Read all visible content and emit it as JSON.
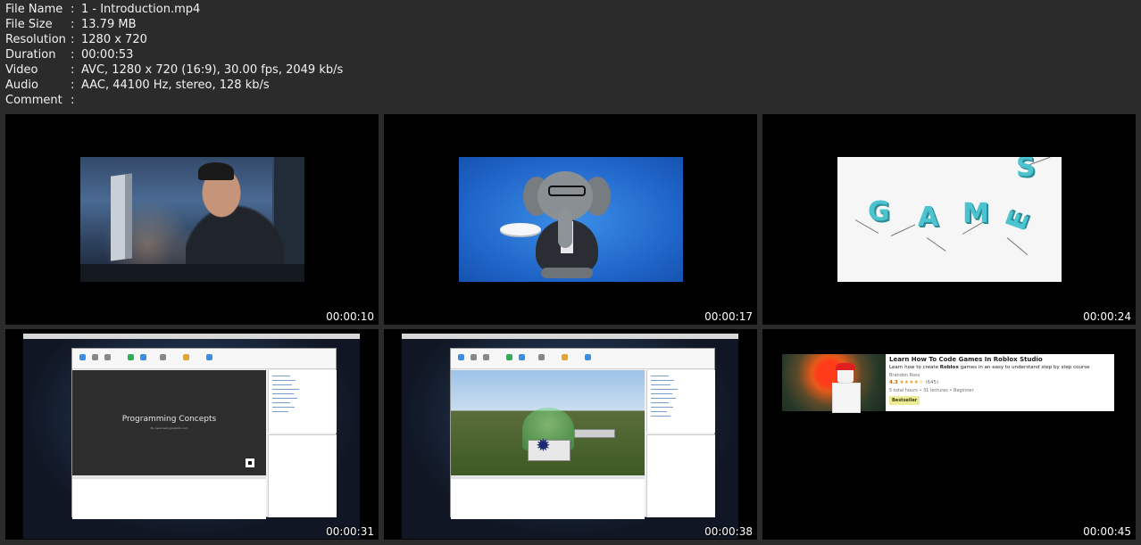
{
  "info": [
    {
      "key": "File Name",
      "value": "1 - Introduction.mp4"
    },
    {
      "key": "File Size",
      "value": "13.79 MB"
    },
    {
      "key": "Resolution",
      "value": "1280 x 720"
    },
    {
      "key": "Duration",
      "value": "00:00:53"
    },
    {
      "key": "Video",
      "value": "AVC, 1280 x 720 (16:9), 30.00 fps, 2049 kb/s"
    },
    {
      "key": "Audio",
      "value": "AAC, 44100 Hz, stereo, 128 kb/s"
    },
    {
      "key": "Comment",
      "value": ""
    }
  ],
  "separator": ":",
  "thumbnails": [
    {
      "timestamp": "00:00:10"
    },
    {
      "timestamp": "00:00:17"
    },
    {
      "timestamp": "00:00:24"
    },
    {
      "timestamp": "00:00:31"
    },
    {
      "timestamp": "00:00:38"
    },
    {
      "timestamp": "00:00:45"
    }
  ],
  "frame3": {
    "letters": [
      "G",
      "A",
      "M",
      "E",
      "S"
    ]
  },
  "frame4": {
    "slide_title": "Programming Concepts",
    "slide_subtitle": "By www.reallygreatsite.com"
  },
  "course_card": {
    "title": "Learn How To Code Games In Roblox Studio",
    "description_pre": "Learn how to create ",
    "description_bold": "Roblox",
    "description_post": " games in an easy to understand step by step course",
    "author": "Brandon Ross",
    "rating": "4.3",
    "stars": "★★★★☆",
    "rating_count": "(645)",
    "details": "5 total hours • 31 lectures • Beginner",
    "badge": "Bestseller"
  }
}
